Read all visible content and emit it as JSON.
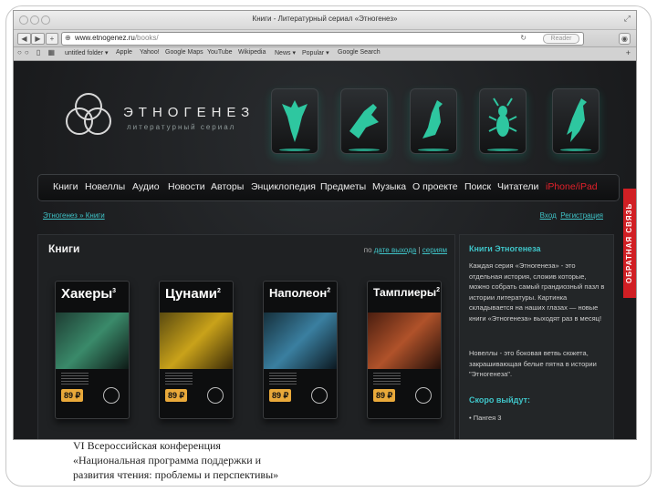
{
  "window": {
    "title": "Книги - Литературный сериал «Этногенез»"
  },
  "toolbar": {
    "url_host": "www.etnogenez.ru",
    "url_path": "/books/",
    "reader": "Reader"
  },
  "bookmarks": [
    "untitled folder ▾",
    "Apple",
    "Yahoo!",
    "Google Maps",
    "YouTube",
    "Wikipedia",
    "News ▾",
    "Popular ▾",
    "Google Search"
  ],
  "site": {
    "logo_title": "ЭТНОГЕНЕЗ",
    "logo_sub": "литературный сериал"
  },
  "nav": [
    "Книги",
    "Новеллы",
    "Аудио",
    "Новости",
    "Авторы",
    "Энциклопедия",
    "Предметы",
    "Музыка",
    "О проекте",
    "Поиск",
    "Читатели",
    "iPhone/iPad"
  ],
  "breadcrumbs": {
    "home": "Этногенез",
    "sep": " » ",
    "current": "Книги"
  },
  "auth": {
    "login": "Вход",
    "register": "Регистрация"
  },
  "main": {
    "title": "Книги",
    "sort_prefix": "по",
    "sort_date": "дате выхода",
    "sort_sep": "|",
    "sort_series": "сериям",
    "books": [
      {
        "title": "Хакеры",
        "num": "3",
        "price": "89 ₽",
        "color": "#3a8a6a"
      },
      {
        "title": "Цунами",
        "num": "2",
        "price": "89 ₽",
        "color": "#c9a21a"
      },
      {
        "title": "Наполеон",
        "num": "2",
        "price": "89 ₽",
        "color": "#3a7fa0"
      },
      {
        "title": "Тамплиеры",
        "num": "2",
        "price": "89 ₽",
        "color": "#b0522a"
      }
    ]
  },
  "sidebar": {
    "heading": "Книги Этногенеза",
    "para1": "Каждая серия «Этногенеза» - это отдельная история, сложив которые, можно собрать самый грандиозный пазл в истории литературы. Картинка складывается на наших глазах — новые книги «Этногенеза» выходят раз в месяц!",
    "para2": "Новеллы - это боковая ветвь сюжета, закрашивающая белые пятна в истории \"Этногенеза\".",
    "soon_heading": "Скоро выйдут:",
    "soon_items": [
      "Пангея 3"
    ]
  },
  "feedback": "ОБРАТНАЯ СВЯЗЬ",
  "caption": {
    "line1": "VI Всероссийская конференция",
    "line2": "«Национальная программа поддержки и",
    "line3": "развития чтения: проблемы и перспективы»"
  }
}
